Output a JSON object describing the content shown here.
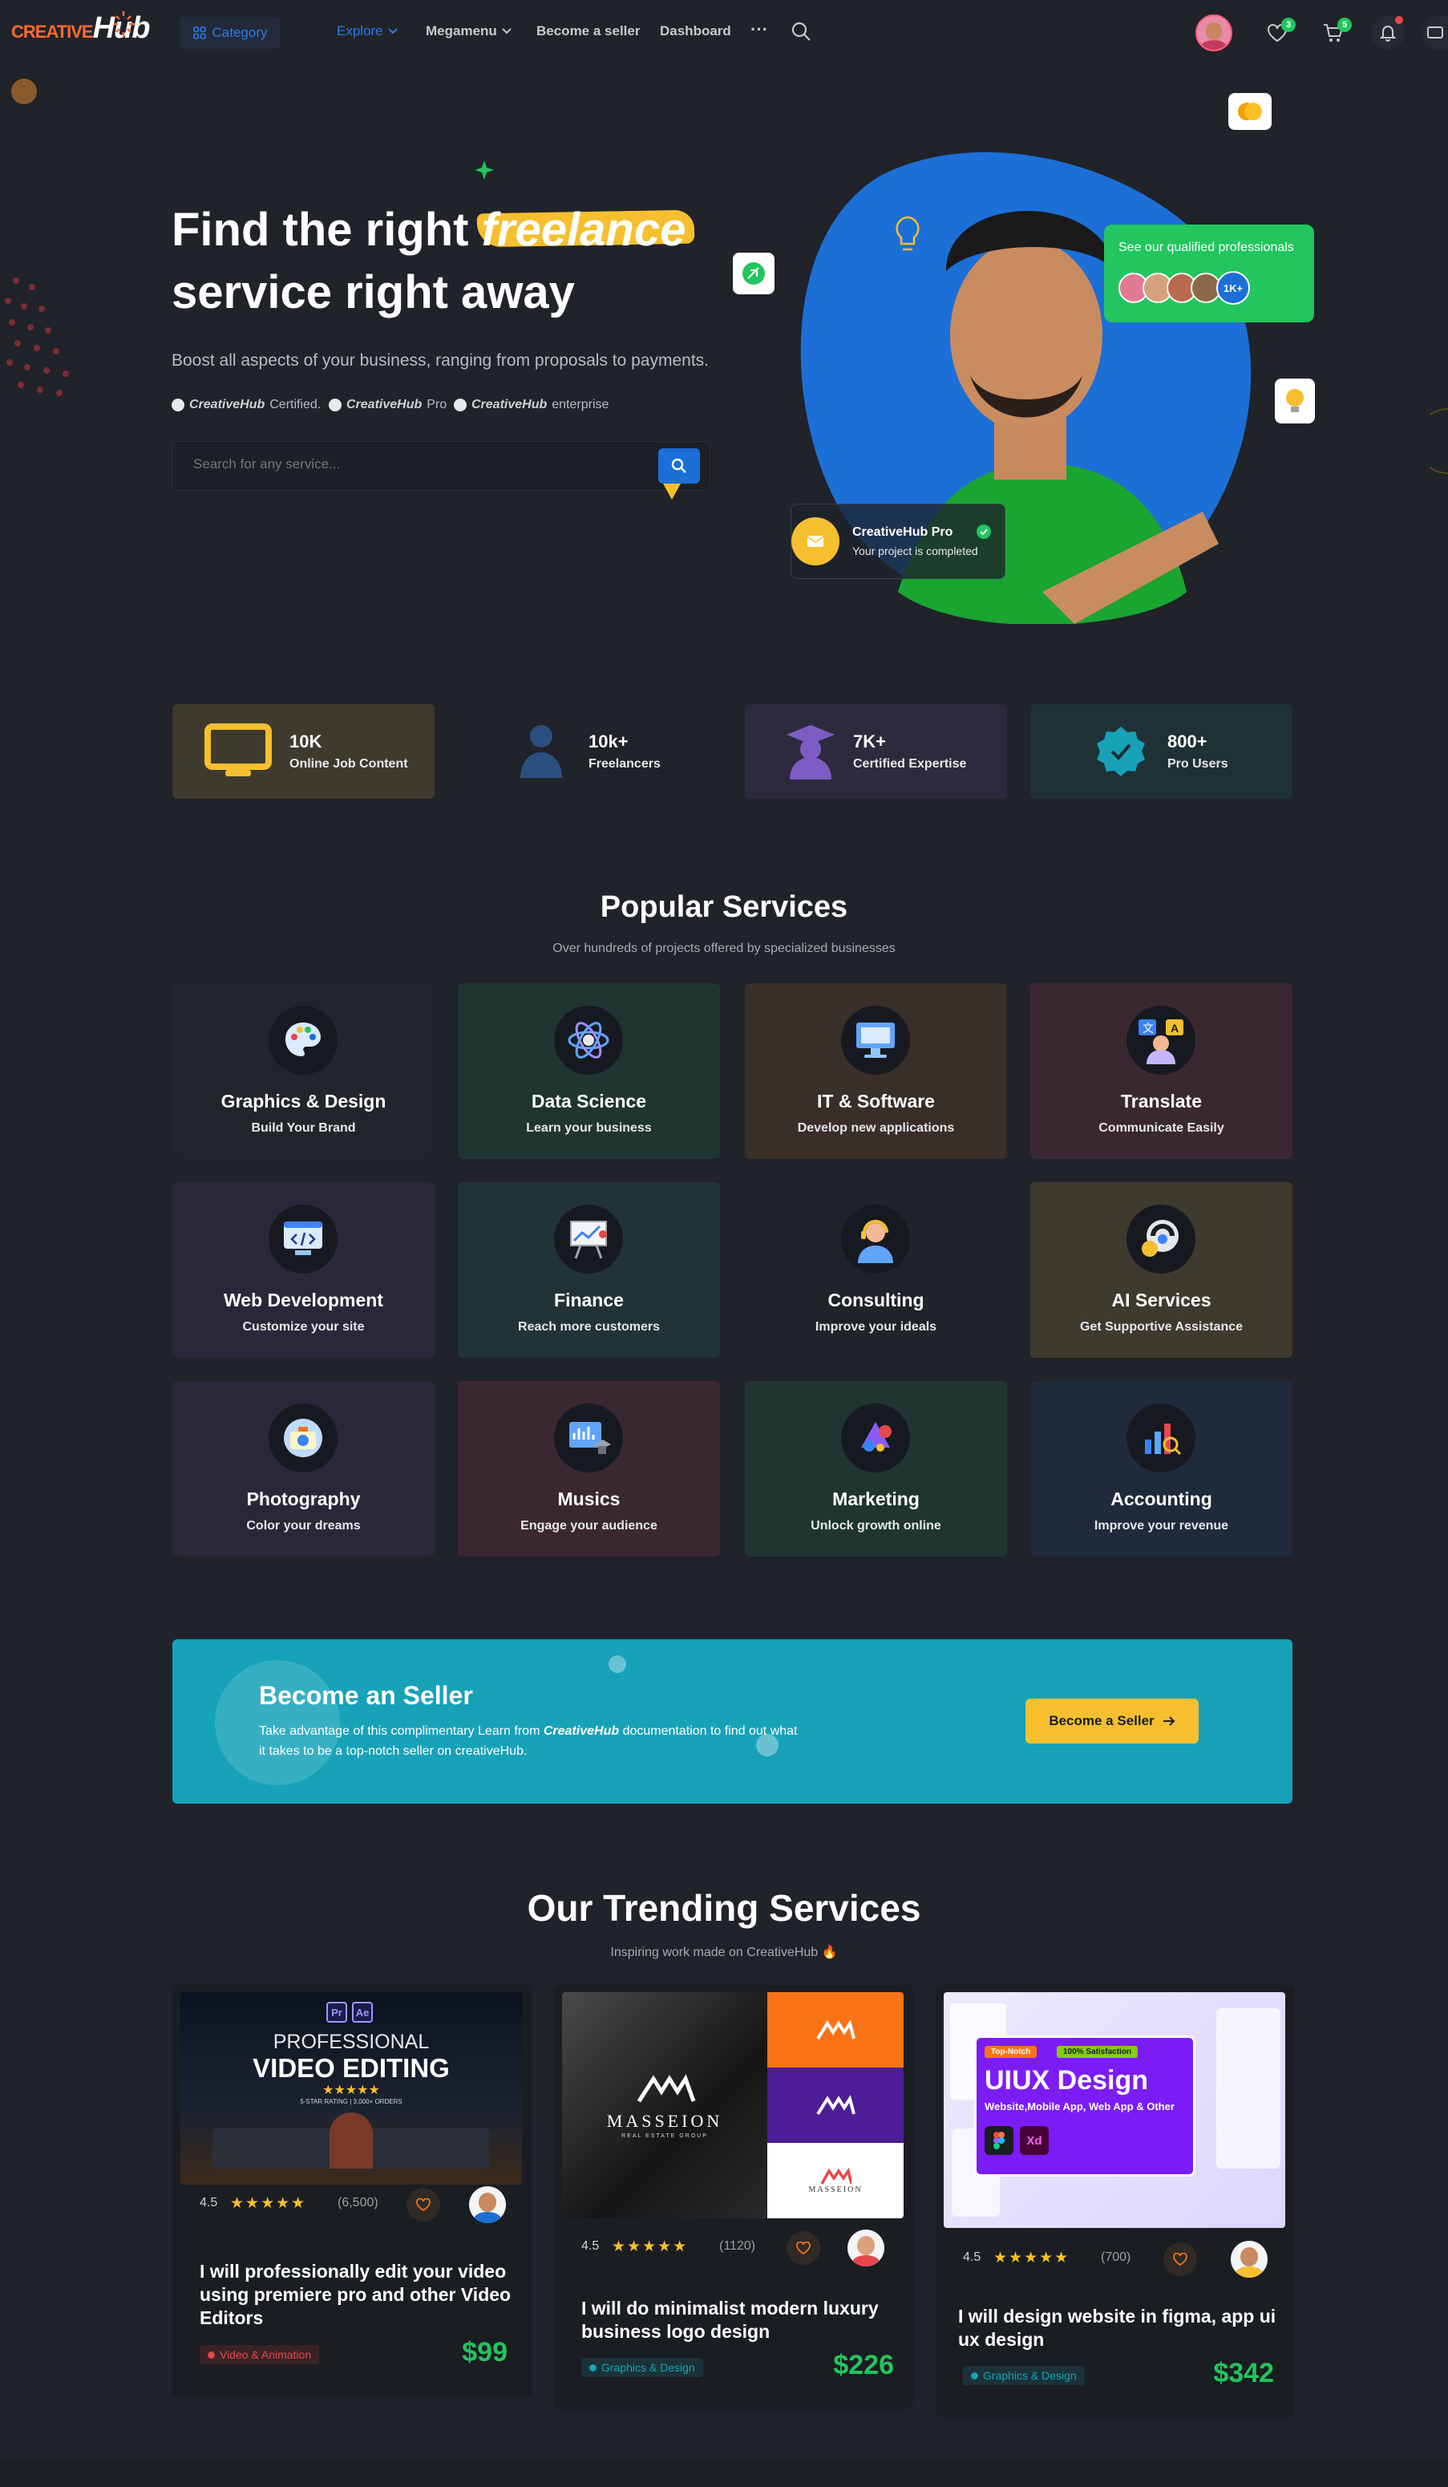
{
  "nav": {
    "logo_prefix": "CREATIVE",
    "logo_hub": "Hub",
    "category": "Category",
    "items": [
      "Explore",
      "Megamenu",
      "Become a seller",
      "Dashboard"
    ],
    "wishlist_count": "3",
    "cart_count": "5"
  },
  "hero": {
    "title_before": "Find the right",
    "title_highlight": "freelance",
    "title_after": "service right away",
    "subtitle": "Boost all aspects of your business, ranging from proposals to payments.",
    "certs": [
      {
        "brand": "CreativeHub",
        "suffix": "Certified."
      },
      {
        "brand": "CreativeHub",
        "suffix": "Pro"
      },
      {
        "brand": "CreativeHub",
        "suffix": "enterprise"
      }
    ],
    "search_placeholder": "Search for any service...",
    "qualified_text": "See our qualified professionals",
    "qualified_count": "1K+",
    "pro_title": "CreativeHub Pro",
    "pro_sub": "Your project is completed"
  },
  "stats": [
    {
      "num": "10K",
      "label": "Online Job Content",
      "bg": "#3f3a2e",
      "color": "#f5bf2f"
    },
    {
      "num": "10k+",
      "label": "Freelancers",
      "bg": "#202329",
      "color": "#2b4f7e"
    },
    {
      "num": "7K+",
      "label": "Certified Expertise",
      "bg": "#2d2a3d",
      "color": "#7c5cc4"
    },
    {
      "num": "800+",
      "label": "Pro Users",
      "bg": "#1f3036",
      "color": "#17a2b8"
    }
  ],
  "popular": {
    "title": "Popular Services",
    "subtitle": "Over hundreds of projects offered by specialized businesses",
    "items": [
      {
        "title": "Graphics & Design",
        "sub": "Build Your Brand",
        "bg": "#22252b",
        "icon": "palette-icon"
      },
      {
        "title": "Data Science",
        "sub": "Learn your business",
        "bg": "#203530",
        "icon": "atom-icon"
      },
      {
        "title": "IT & Software",
        "sub": "Develop new applications",
        "bg": "#3a2e29",
        "icon": "computer-icon"
      },
      {
        "title": "Translate",
        "sub": "Communicate Easily",
        "bg": "#3a2830",
        "icon": "translate-icon"
      },
      {
        "title": "Web Development",
        "sub": "Customize your site",
        "bg": "#2a2838",
        "icon": "code-screen-icon"
      },
      {
        "title": "Finance",
        "sub": "Reach more customers",
        "bg": "#213337",
        "icon": "chart-board-icon"
      },
      {
        "title": "Consulting",
        "sub": "Improve your ideals",
        "bg": "#202329",
        "icon": "headset-icon"
      },
      {
        "title": "AI Services",
        "sub": "Get Supportive Assistance",
        "bg": "#3f3a2e",
        "icon": "ai-helmet-icon"
      },
      {
        "title": "Photography",
        "sub": "Color your dreams",
        "bg": "#2a2838",
        "icon": "camera-icon"
      },
      {
        "title": "Musics",
        "sub": "Engage your audience",
        "bg": "#3a2830",
        "icon": "music-icon"
      },
      {
        "title": "Marketing",
        "sub": "Unlock growth online",
        "bg": "#203530",
        "icon": "marketing-icon"
      },
      {
        "title": "Accounting",
        "sub": "Improve your revenue",
        "bg": "#1f2a3a",
        "icon": "accounting-icon"
      }
    ]
  },
  "seller": {
    "title": "Become an Seller",
    "text_before": "Take advantage of this complimentary Learn from",
    "brand": "CreativeHub",
    "text_after": "documentation to find out what it takes to be a top-notch seller on creativeHub.",
    "button": "Become a Seller"
  },
  "trending": {
    "title": "Our Trending Services",
    "subtitle": "Inspiring work made on CreativeHub",
    "cards": [
      {
        "rating": "4.5",
        "reviews": "(6,500)",
        "title": "I will professionally edit your video using premiere pro and other Video Editors",
        "tag": "Video & Animation",
        "tag_color": "#e5484d",
        "price": "$99",
        "thumb_badges": [
          "Pr",
          "Ae"
        ],
        "thumb_line1": "PROFESSIONAL",
        "thumb_line2": "VIDEO EDITING",
        "thumb_line3": "5-STAR RATING | 3,000+ ORDERS"
      },
      {
        "rating": "4.5",
        "reviews": "(1120)",
        "title": "I will do minimalist modern luxury business logo design",
        "tag": "Graphics & Design",
        "tag_color": "#17a2b8",
        "price": "$226",
        "thumb_brand": "MASSEION",
        "thumb_brand_sub": "REAL ESTATE GROUP"
      },
      {
        "rating": "4.5",
        "reviews": "(700)",
        "title": "I will design website in figma, app ui ux design",
        "tag": "Graphics & Design",
        "tag_color": "#17a2b8",
        "price": "$342",
        "thumb_pill1": "Top-Notch",
        "thumb_pill2": "100% Satisfaction",
        "thumb_title": "UIUX Design",
        "thumb_sub": "Website,Mobile App, Web App & Other",
        "thumb_badges": [
          "Xd"
        ]
      }
    ]
  }
}
